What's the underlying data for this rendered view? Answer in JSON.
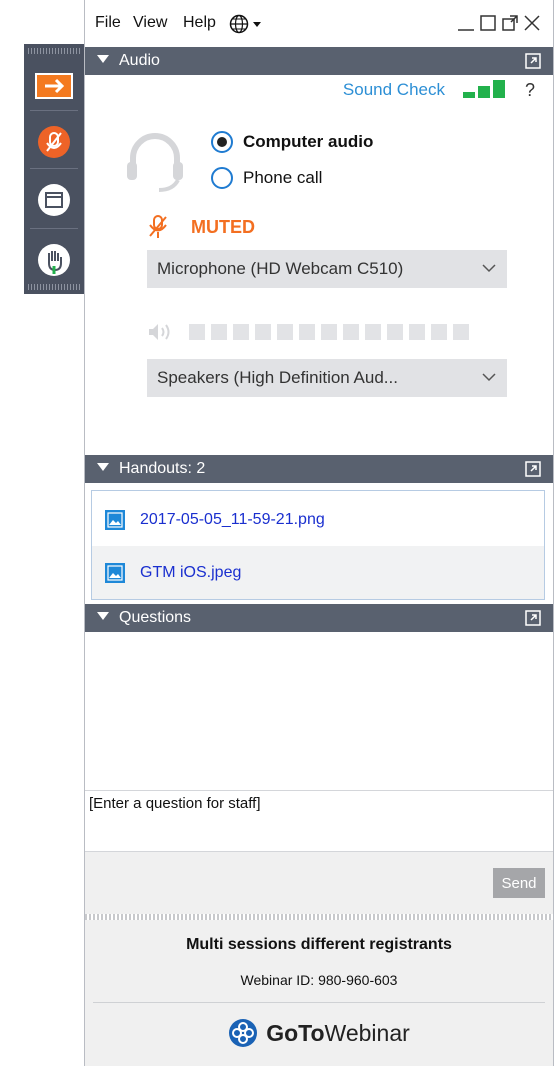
{
  "menubar": {
    "file": "File",
    "view": "View",
    "help": "Help",
    "globe_icon": "globe-icon",
    "window_controls": [
      "minimize-icon",
      "maximize-icon",
      "popout-icon",
      "close-icon"
    ]
  },
  "sidebar": {
    "buttons": [
      "expand-arrow-icon",
      "microphone-muted-icon",
      "screen-icon",
      "raise-hand-icon"
    ]
  },
  "audio": {
    "header": "Audio",
    "sound_check": "Sound Check",
    "help": "?",
    "options": [
      {
        "label": "Computer audio",
        "selected": true
      },
      {
        "label": "Phone call",
        "selected": false
      }
    ],
    "muted_label": "MUTED",
    "microphone": "Microphone (HD Webcam C510)",
    "speakers": "Speakers (High Definition Aud...",
    "speaker_level": 0
  },
  "handouts": {
    "header": "Handouts: 2",
    "files": [
      "2017-05-05_11-59-21.png",
      "GTM iOS.jpeg"
    ]
  },
  "questions": {
    "header": "Questions",
    "input_placeholder": "[Enter a question for staff]",
    "send_label": "Send"
  },
  "footer": {
    "webinar_title": "Multi sessions different registrants",
    "webinar_id": "Webinar ID: 980-960-603",
    "logo_bold": "GoTo",
    "logo_light": "Webinar"
  },
  "colors": {
    "header_bg": "#59616f",
    "accent_blue": "#2d8fd5",
    "muted_orange": "#f36f21",
    "signal_green": "#22b14c",
    "link_blue": "#1a2fcf"
  }
}
